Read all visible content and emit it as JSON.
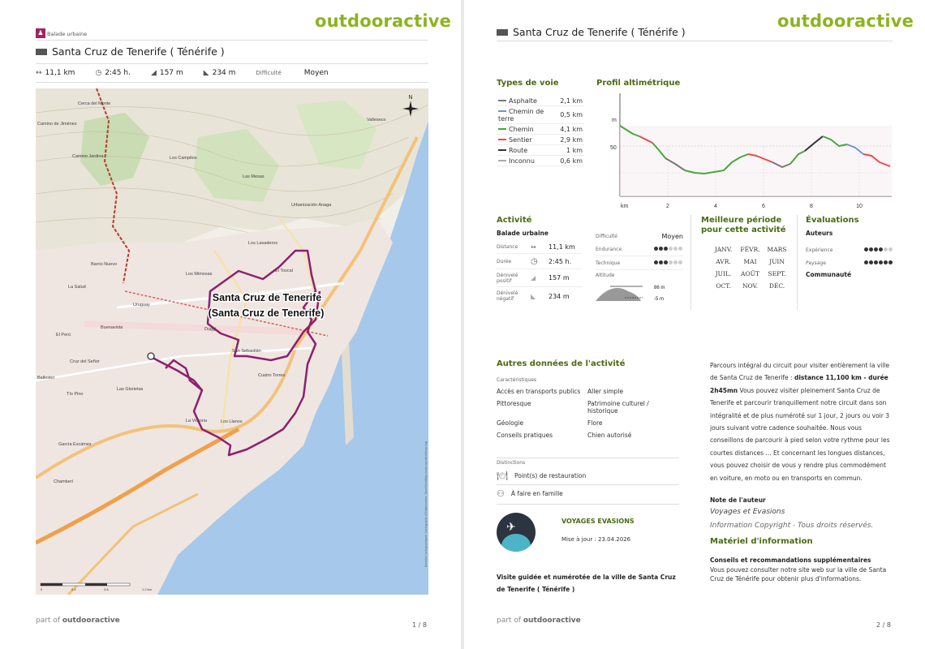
{
  "brand": "outdooractive",
  "page1": {
    "category": "Balade urbaine",
    "title": "Santa Cruz de Tenerife ( Ténérife )",
    "metrics": {
      "distance": "11,1 km",
      "duration": "2:45 h.",
      "ascent": "157 m",
      "descent": "234 m",
      "difficulty_label": "Difficulté",
      "difficulty_value": "Moyen"
    },
    "map": {
      "route_label_line1": "Santa Cruz de Tenerife",
      "route_label_line2": "(Santa Cruz de Tenerife)",
      "north": "N",
      "scale_labels": [
        "0",
        "0.4",
        "0.8",
        "1.2 km"
      ],
      "attribution": "Données cartographiques: Cartographie d'Outdooractive, OpenStreetMap (www.openstreetmap.org)",
      "places": [
        "Camino de Jiménez",
        "Cerca del Monte",
        "Camino Jardina",
        "Los Campitos",
        "Valleseco",
        "Las Mesas",
        "Urbanización Anaga",
        "Los Lavaderos",
        "Barrio Nuevo",
        "Los Mimosas",
        "El Toscal",
        "La Salud",
        "Uruguay",
        "Buenavista",
        "El Perú",
        "Cruz del Señor",
        "Ballester",
        "Tío Pino",
        "Las Glorietas",
        "La Victoria",
        "Los Llanos",
        "García Escámez",
        "Chamberí",
        "Cuatro Torres",
        "San Sebastián",
        "Duggi"
      ]
    },
    "footer": {
      "part_of": "part of",
      "brand": "outdooractive",
      "page": "1 / 8"
    }
  },
  "page2": {
    "title": "Santa Cruz de Tenerife ( Ténérife )",
    "road_types": {
      "heading": "Types de voie",
      "rows": [
        {
          "name": "Asphalte",
          "value": "2,1 km",
          "color": "#777777"
        },
        {
          "name": "Chemin de terre",
          "value": "0,5 km",
          "color": "#6f93d5"
        },
        {
          "name": "Chemin",
          "value": "4,1 km",
          "color": "#48a83a"
        },
        {
          "name": "Sentier",
          "value": "2,9 km",
          "color": "#e84a4a"
        },
        {
          "name": "Route",
          "value": "1 km",
          "color": "#333333"
        },
        {
          "name": "Inconnu",
          "value": "0,6 km",
          "color": "#aaaaaa"
        }
      ]
    },
    "elevation": {
      "heading": "Profil altimétrique",
      "y_unit": "m",
      "y_tick": "50",
      "x_unit": "km",
      "x_ticks": [
        "2",
        "4",
        "6",
        "8",
        "10"
      ]
    },
    "activity": {
      "heading": "Activité",
      "type": "Balade urbaine",
      "distance_label": "Distance",
      "distance": "11,1 km",
      "duration_label": "Durée",
      "duration": "2:45 h.",
      "ascent_label": "Dénivelé positif",
      "ascent": "157 m",
      "descent_label": "Dénivelé négatif",
      "descent": "234 m",
      "difficulty_label": "Difficulté",
      "difficulty": "Moyen",
      "endurance_label": "Endurance",
      "endurance_level": 3,
      "technique_label": "Technique",
      "technique_level": 3,
      "altitude_label": "Altitude",
      "altitude_max": "86 m",
      "altitude_min": "-5 m"
    },
    "best_period": {
      "heading": "Meilleure période pour cette activité",
      "months": [
        "JANV.",
        "FÉVR.",
        "MARS",
        "AVR.",
        "MAI",
        "JUIN",
        "JUIL.",
        "AOÛT",
        "SEPT.",
        "OCT.",
        "NOV.",
        "DÉC."
      ]
    },
    "ratings": {
      "heading": "Évaluations",
      "authors": "Auteurs",
      "experience_label": "Expérience",
      "experience_level": 4,
      "landscape_label": "Paysage",
      "landscape_level": 6,
      "community": "Communauté"
    },
    "other": {
      "heading": "Autres données de l'activité",
      "characteristics_label": "Caractéristiques",
      "characteristics": [
        "Accès en transports publics",
        "Aller simple",
        "Pittoresque",
        "Patrimoine culturel / historique",
        "Géologie",
        "Flore",
        "Conseils pratiques",
        "Chien autorisé"
      ],
      "distinctions_label": "Distinctions",
      "distinctions": [
        "Point(s) de restauration",
        "À faire en famille"
      ]
    },
    "author": {
      "name": "VOYAGES EVASIONS",
      "updated": "Mise à jour : 23.04.2026"
    },
    "teaser": "Visite guidée et numérotée de la ville de Santa Cruz de Tenerife ( Ténérife )",
    "description": {
      "before": "Parcours intégral du circuit pour visiter entièrement la ville de Santa Cruz de Tenerife : ",
      "bold": "distance 11,100 km - durée 2h45mn",
      "after": " Vous pouvez visiter pleinement Santa Cruz de Tenerife et parcourir tranquillement notre circuit dans son intégralité et de plus numéroté sur 1 jour, 2 jours ou voir 3 jours suivant votre cadence souhaitée. Nous vous conseillons de parcourir à pied selon votre rythme pour les courtes distances ... Et concernant les longues distances, vous pouvez choisir de vous y rendre plus commodément en voiture, en moto ou en transports en commun."
    },
    "author_note_label": "Note de l'auteur",
    "author_note_1": "Voyages et Evasions",
    "author_note_2": "Information Copyright - Tous droits réservés.",
    "material_heading": "Matériel d'information",
    "advice_title": "Conseils et recommandations supplémentaires",
    "advice_text": "Vous pouvez consulter notre site web sur la ville de Santa Cruz de Ténérife pour obtenir plus d'informations.",
    "footer": {
      "part_of": "part of",
      "brand": "outdooractive",
      "page": "2 / 8"
    }
  }
}
